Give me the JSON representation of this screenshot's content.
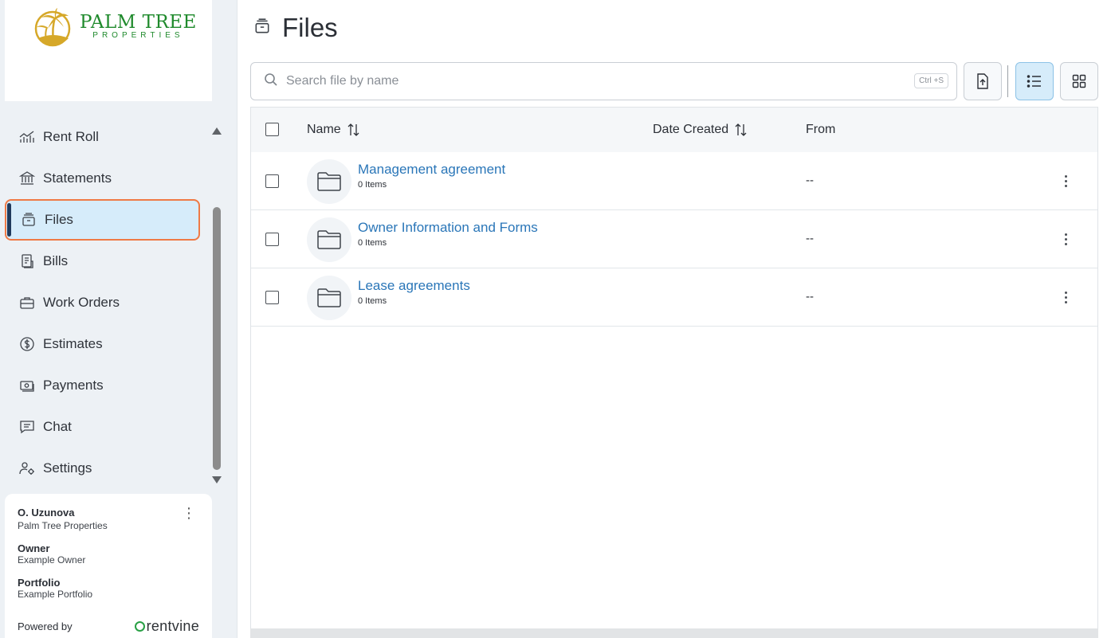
{
  "brand": {
    "name": "PALM TREE",
    "subtitle": "PROPERTIES",
    "colors": {
      "green": "#1f8a2c",
      "gold": "#d6a829"
    }
  },
  "sidebar": {
    "items": [
      {
        "label": "Rent Roll",
        "icon": "chart-icon"
      },
      {
        "label": "Statements",
        "icon": "bank-icon"
      },
      {
        "label": "Files",
        "icon": "archive-icon",
        "active": true
      },
      {
        "label": "Bills",
        "icon": "receipt-icon"
      },
      {
        "label": "Work Orders",
        "icon": "briefcase-icon"
      },
      {
        "label": "Estimates",
        "icon": "dollar-circle-icon"
      },
      {
        "label": "Payments",
        "icon": "cash-icon"
      },
      {
        "label": "Chat",
        "icon": "chat-icon"
      },
      {
        "label": "Settings",
        "icon": "user-gear-icon"
      }
    ],
    "accent_color": "#ef7a45"
  },
  "user": {
    "name": "O. Uzunova",
    "company": "Palm Tree Properties",
    "role_label": "Owner",
    "role_value": "Example Owner",
    "portfolio_label": "Portfolio",
    "portfolio_value": "Example Portfolio",
    "powered_by": "Powered by",
    "powered_brand": "rentvine"
  },
  "main": {
    "title": "Files",
    "search": {
      "placeholder": "Search file by name",
      "shortcut": "Ctrl +S"
    },
    "table": {
      "columns": [
        "Name",
        "Date Created",
        "From"
      ],
      "rows": [
        {
          "name": "Management agreement",
          "count": "0 Items",
          "from": "--"
        },
        {
          "name": "Owner Information and Forms",
          "count": "0 Items",
          "from": "--"
        },
        {
          "name": "Lease agreements",
          "count": "0 Items",
          "from": "--"
        }
      ]
    },
    "link_color": "#2a76b8"
  }
}
